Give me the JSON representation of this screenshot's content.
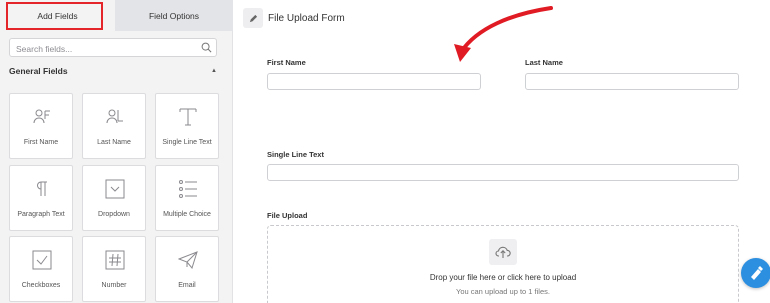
{
  "tabs": {
    "add_fields": "Add Fields",
    "field_options": "Field Options"
  },
  "search": {
    "placeholder": "Search fields..."
  },
  "section": {
    "title": "General Fields"
  },
  "fields": [
    {
      "label": "First Name",
      "icon": "person-icon"
    },
    {
      "label": "Last Name",
      "icon": "person-lines-icon"
    },
    {
      "label": "Single Line Text",
      "icon": "text-t-icon"
    },
    {
      "label": "Paragraph Text",
      "icon": "paragraph-icon"
    },
    {
      "label": "Dropdown",
      "icon": "dropdown-icon"
    },
    {
      "label": "Multiple Choice",
      "icon": "list-icon"
    },
    {
      "label": "Checkboxes",
      "icon": "checkbox-icon"
    },
    {
      "label": "Number",
      "icon": "hash-icon"
    },
    {
      "label": "Email",
      "icon": "paper-plane-icon"
    }
  ],
  "form": {
    "title": "File Upload Form",
    "first_name_label": "First Name",
    "last_name_label": "Last Name",
    "single_line_label": "Single Line Text",
    "file_upload_label": "File Upload",
    "drop_text": "Drop your file here or click here to upload",
    "limit_text": "You can upload up to 1 files."
  },
  "colors": {
    "highlight": "#e4262b",
    "annotation_arrow": "#e01b24",
    "fab": "#2d8fe0"
  }
}
